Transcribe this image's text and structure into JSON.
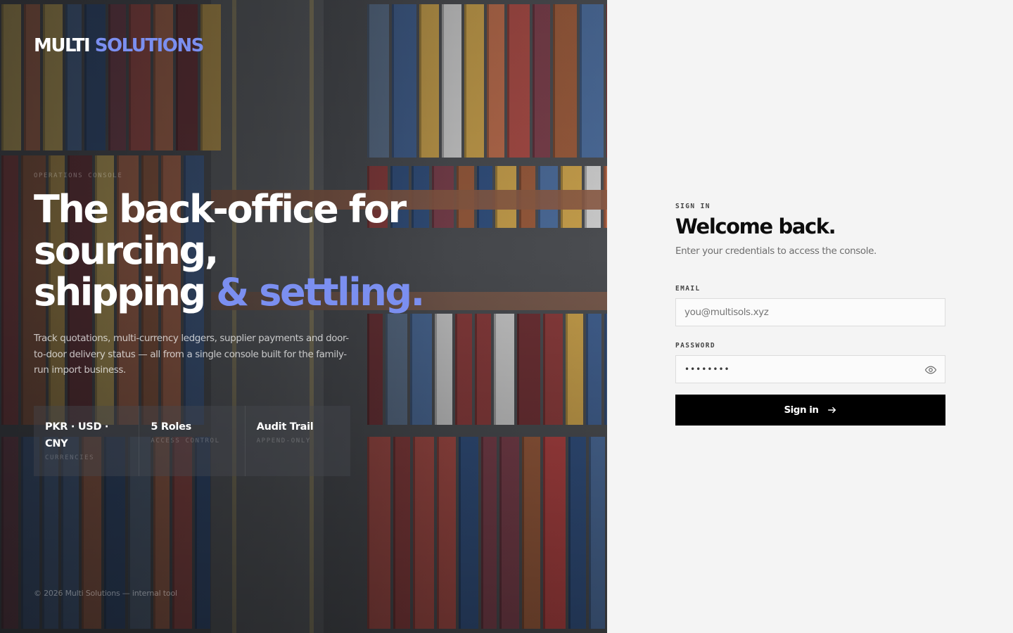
{
  "brand": {
    "primary": "MULTI",
    "accent_word": "SOLUTIONS",
    "accent_color": "#7b8ff0"
  },
  "hero": {
    "kicker": "OPERATIONS CONSOLE",
    "headline": {
      "line1": "The back-office for",
      "line2": "sourcing,",
      "line3_plain": "shipping ",
      "line3_accent": "& settling."
    },
    "lede": "Track quotations, multi-currency ledgers, supplier payments and door-to-door delivery status — all from a single console built for the family-run import business.",
    "stats": [
      {
        "value": "PKR · USD · CNY",
        "label": "CURRENCIES"
      },
      {
        "value": "5 Roles",
        "label": "ACCESS CONTROL"
      },
      {
        "value": "Audit Trail",
        "label": "APPEND-ONLY"
      }
    ],
    "footer": "© 2026 Multi Solutions — internal tool",
    "background_image": "aerial-shipping-containers-photo"
  },
  "signin": {
    "eyebrow": "SIGN IN",
    "title": "Welcome back.",
    "subtitle": "Enter your credentials to access the console.",
    "email": {
      "label": "EMAIL",
      "placeholder": "you@multisols.xyz",
      "value": ""
    },
    "password": {
      "label": "PASSWORD",
      "value": "••••••••",
      "toggle_icon": "eye-icon"
    },
    "submit": {
      "label": "Sign in",
      "icon": "arrow-right-icon",
      "background": "#000000"
    }
  }
}
